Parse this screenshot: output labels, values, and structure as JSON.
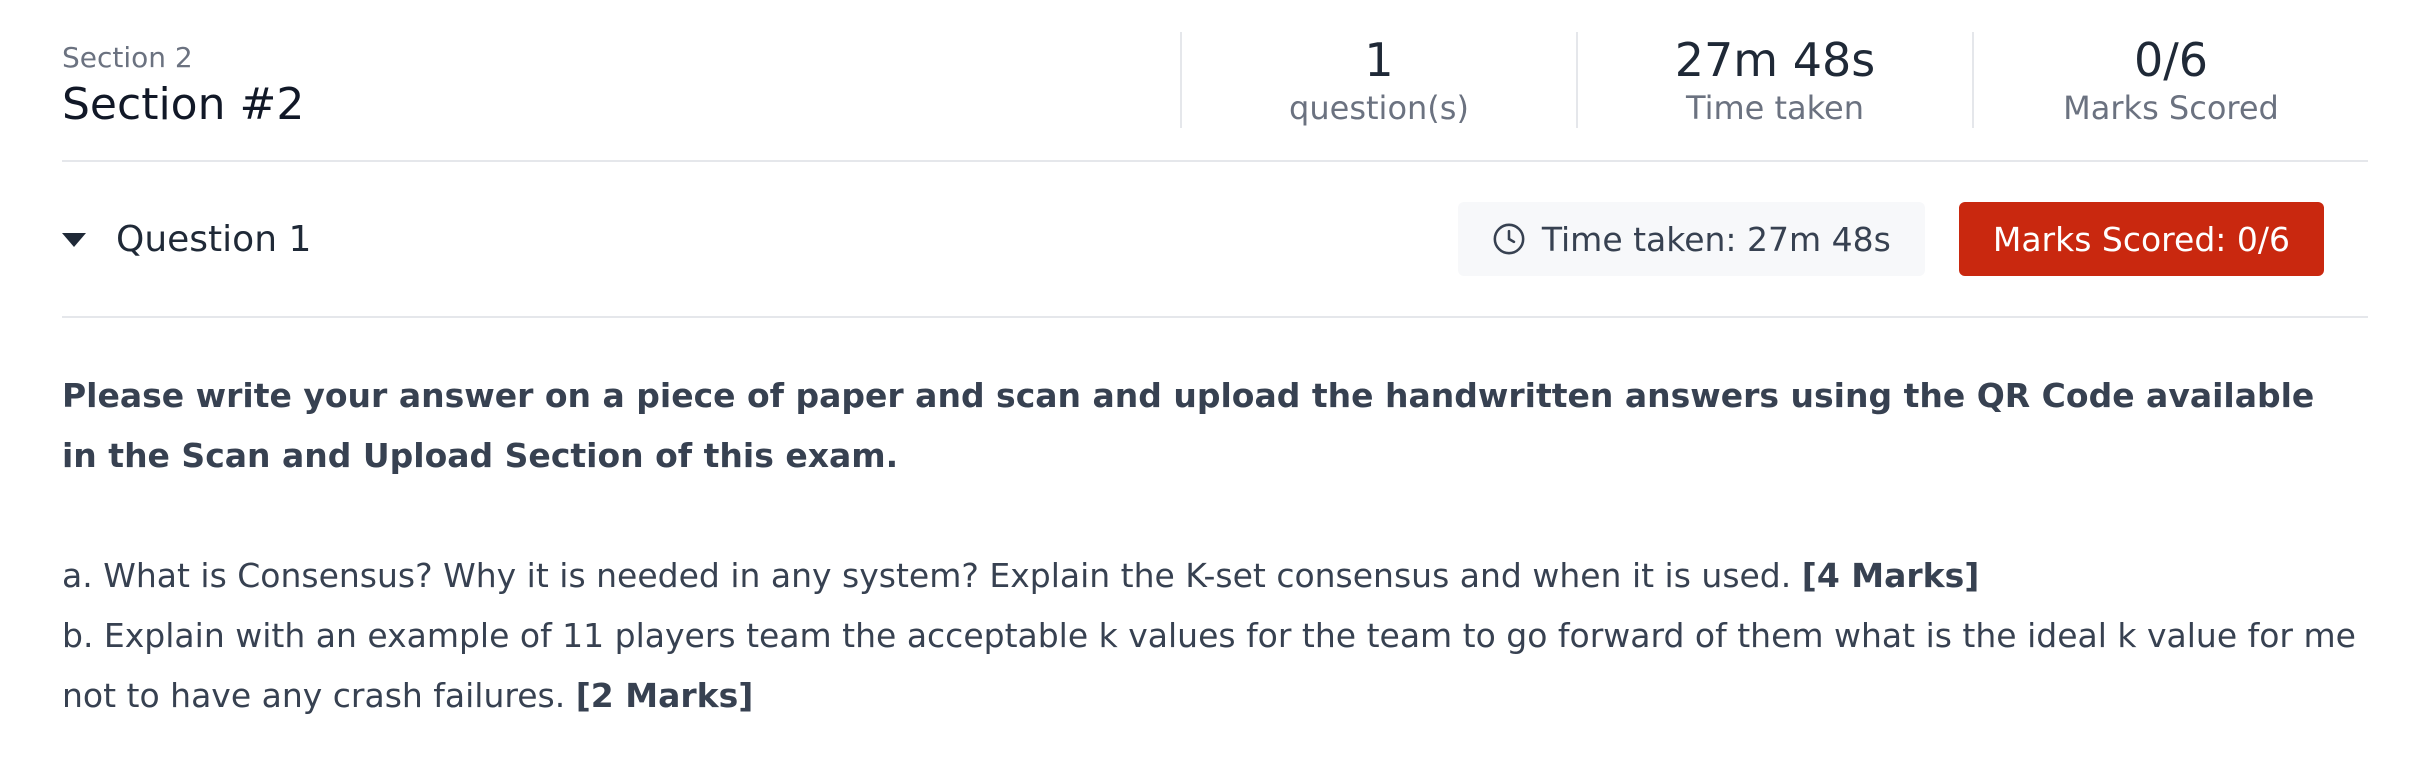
{
  "section": {
    "kicker": "Section 2",
    "title": "Section #2"
  },
  "stats": [
    {
      "value": "1",
      "label": "question(s)"
    },
    {
      "value": "27m 48s",
      "label": "Time taken"
    },
    {
      "value": "0/6",
      "label": "Marks Scored"
    }
  ],
  "question": {
    "title": "Question 1",
    "time_taken": "Time taken: 27m 48s",
    "marks_scored": "Marks Scored: 0/6",
    "instruction": "Please write your answer on a piece of paper and scan and upload the handwritten answers using the QR Code available in the Scan and Upload Section of this exam.",
    "parts": [
      {
        "text": "a. What is Consensus? Why it is needed in any system? Explain the K-set consensus and when it is used. ",
        "marks": "[4 Marks]"
      },
      {
        "text": "b. Explain with an example of 11 players team the acceptable k values for the team to go forward of them what is the ideal k value for me not to have any crash failures.   ",
        "marks": "[2 Marks]"
      }
    ]
  },
  "colors": {
    "accent_red": "#c9280f",
    "pill_bg": "#f7f8fa",
    "divider": "#e5e7eb"
  },
  "icons": {
    "toggle": "caret-down-icon",
    "time": "clock-icon"
  }
}
